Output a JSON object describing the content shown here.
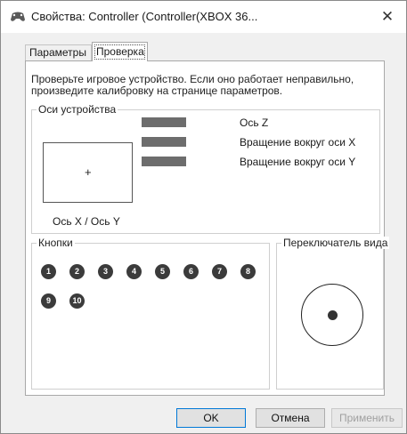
{
  "window": {
    "title": "Свойства: Controller (Controller(XBOX 36...",
    "close_glyph": "✕"
  },
  "tabs": [
    {
      "label": "Параметры",
      "selected": false
    },
    {
      "label": "Проверка",
      "selected": true
    }
  ],
  "test_tab": {
    "intro": "Проверьте игровое устройство. Если оно работает неправильно, произведите калибровку на странице параметров.",
    "axes_group": {
      "label": "Оси устройства",
      "xy_label": "Ось X / Ось Y",
      "crosshair": "+",
      "axes": [
        {
          "label": "Ось Z",
          "level": 1.0
        },
        {
          "label": "Вращение вокруг оси X",
          "level": 1.0
        },
        {
          "label": "Вращение вокруг оси Y",
          "level": 1.0
        }
      ]
    },
    "buttons_group": {
      "label": "Кнопки",
      "buttons": [
        "1",
        "2",
        "3",
        "4",
        "5",
        "6",
        "7",
        "8",
        "9",
        "10"
      ]
    },
    "pov_group": {
      "label": "Переключатель вида"
    }
  },
  "footer": {
    "ok_label": "OK",
    "cancel_label": "Отмена",
    "apply_label": "Применить",
    "apply_enabled": false
  },
  "colors": {
    "accent": "#0078d7",
    "button_indicator": "#3b3b3b",
    "axis_bar": "#6d6d6d"
  }
}
